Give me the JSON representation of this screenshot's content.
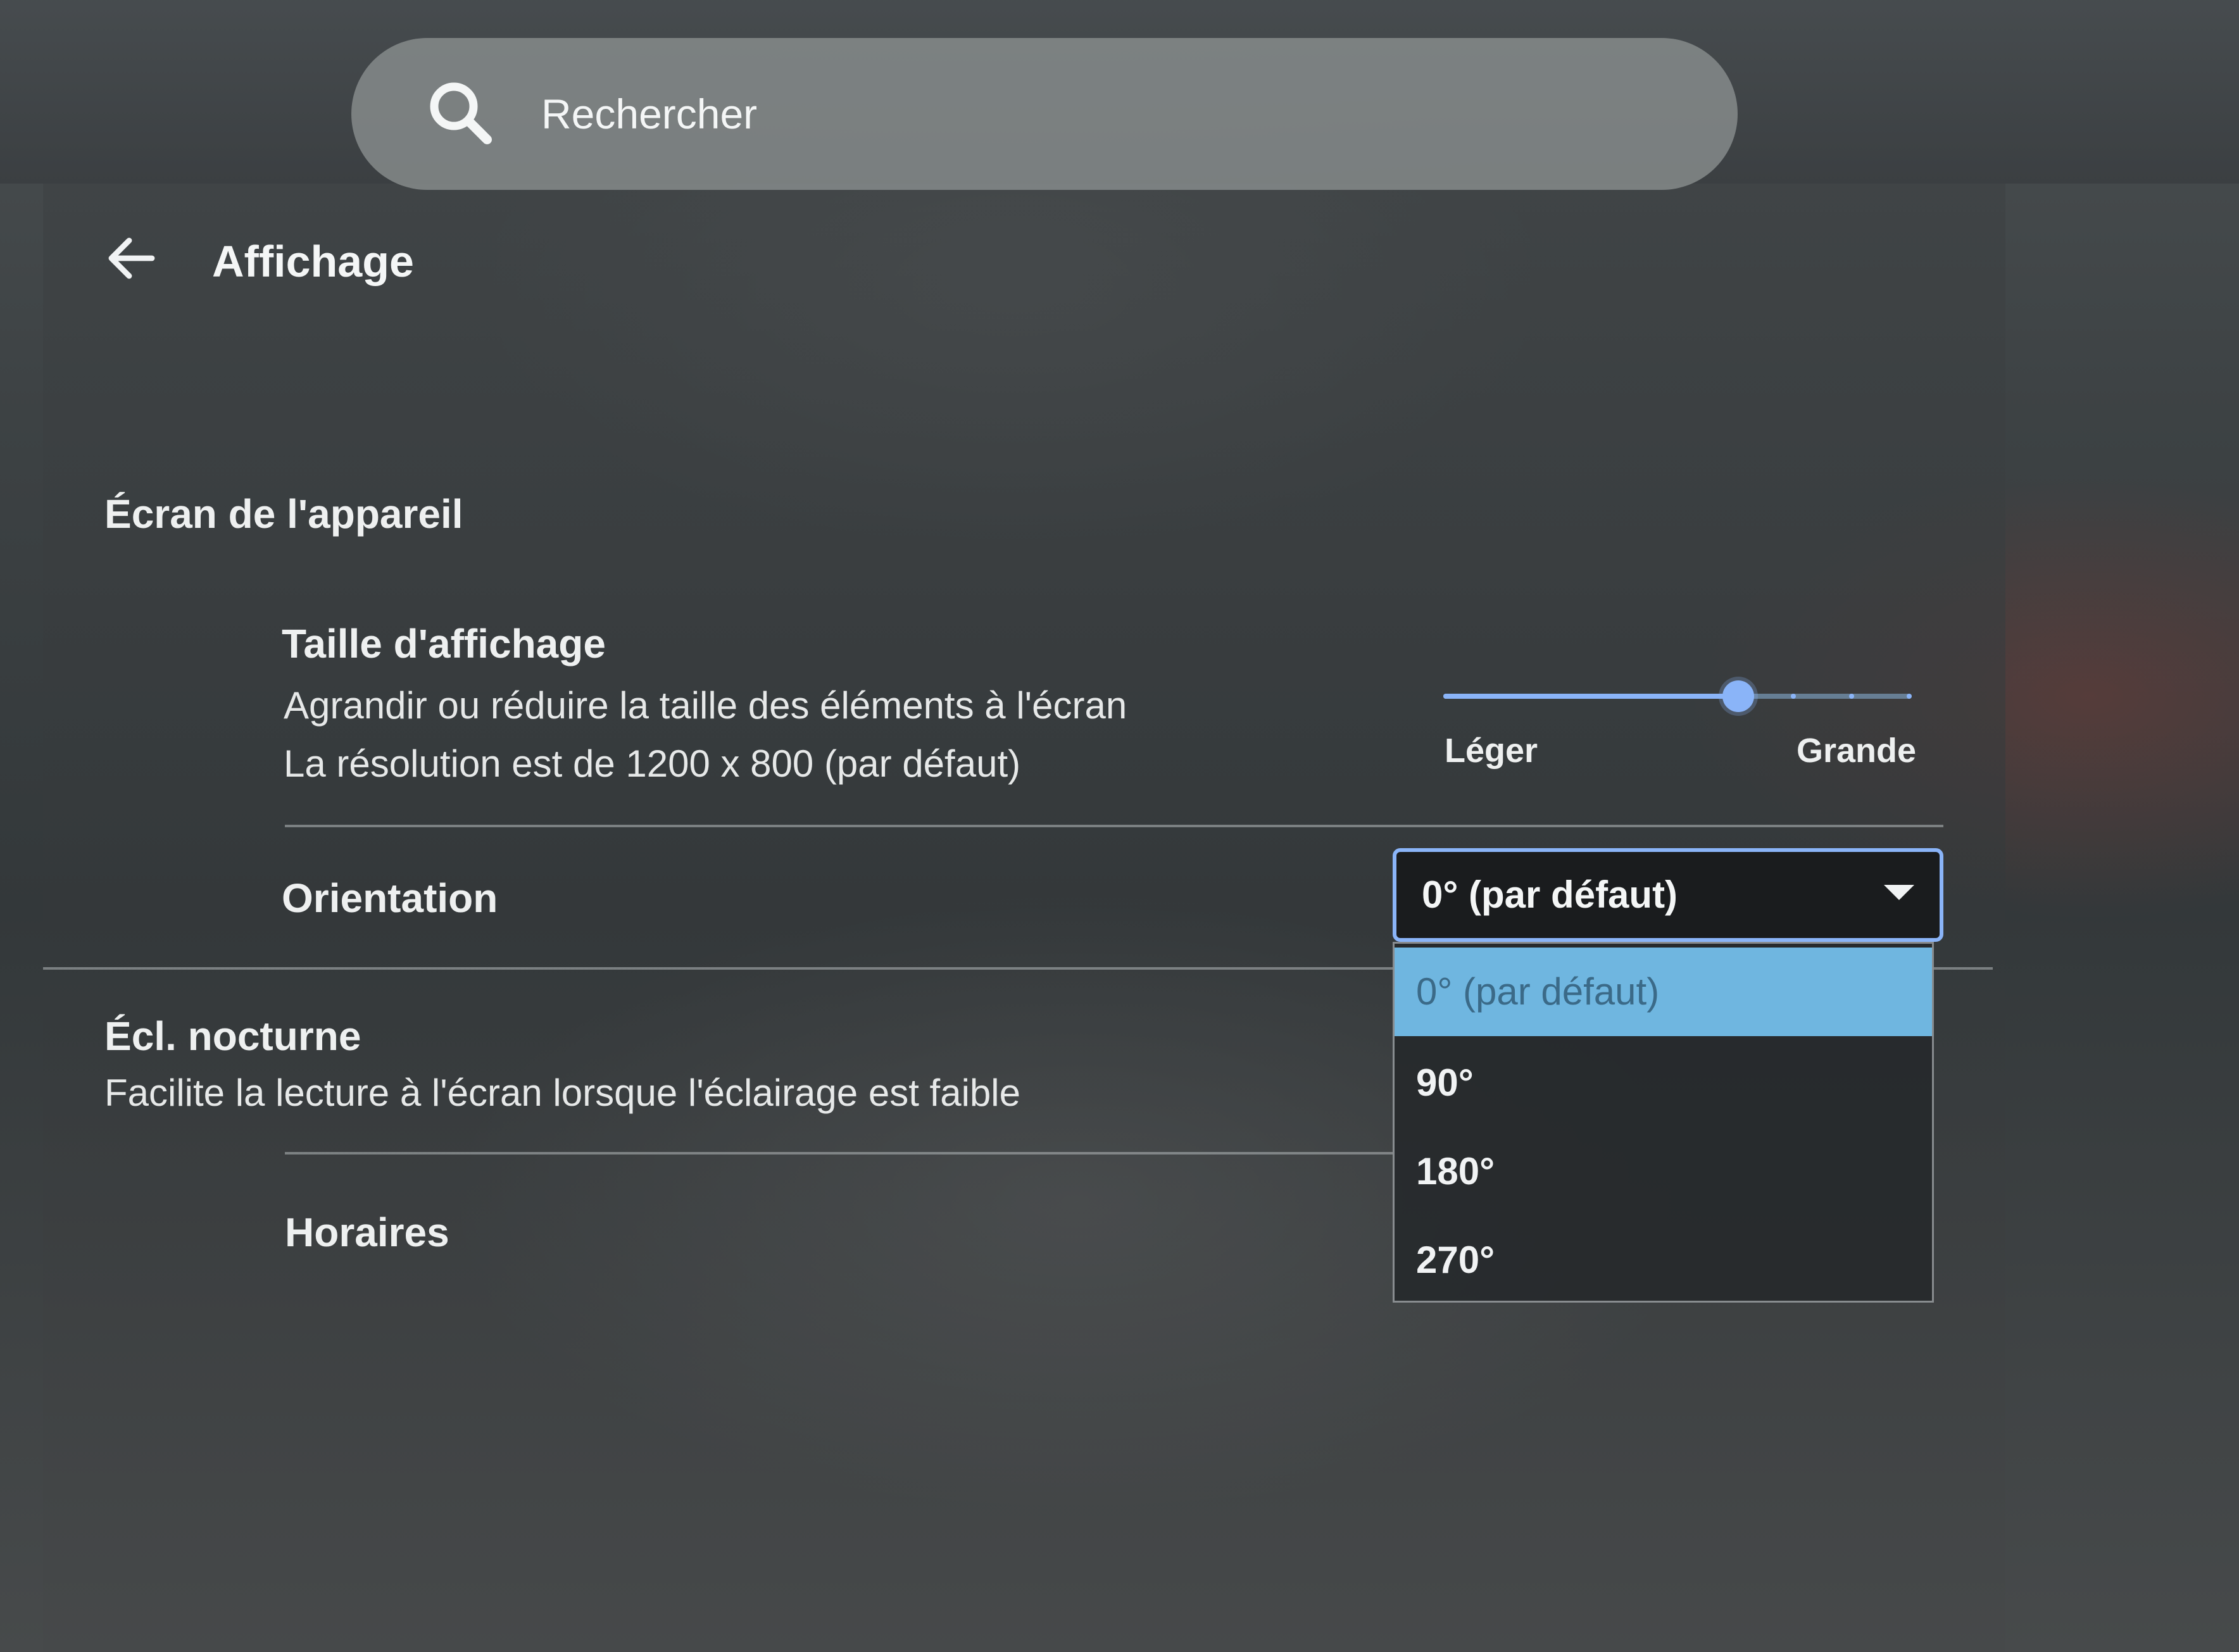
{
  "search": {
    "placeholder": "Rechercher"
  },
  "header": {
    "title": "Affichage"
  },
  "device_screen": {
    "section_title": "Écran de l'appareil",
    "display_size": {
      "title": "Taille d'affichage",
      "description": "Agrandir ou réduire la taille des éléments à l'écran",
      "resolution": "La résolution est de 1200 x 800 (par défaut)",
      "slider_min_label": "Léger",
      "slider_max_label": "Grande",
      "slider_value": 0.63,
      "slider_steps": 9
    },
    "orientation": {
      "label": "Orientation",
      "selected": "0° (par défaut)",
      "options": [
        "0° (par défaut)",
        "90°",
        "180°",
        "270°"
      ]
    }
  },
  "night_light": {
    "title": "Écl. nocturne",
    "description": "Facilite la lecture à l'écran lorsque l'éclairage est faible",
    "schedule_label": "Horaires"
  },
  "colors": {
    "accent": "#8ab4f8",
    "selected_option_bg": "#6fb6e0"
  }
}
